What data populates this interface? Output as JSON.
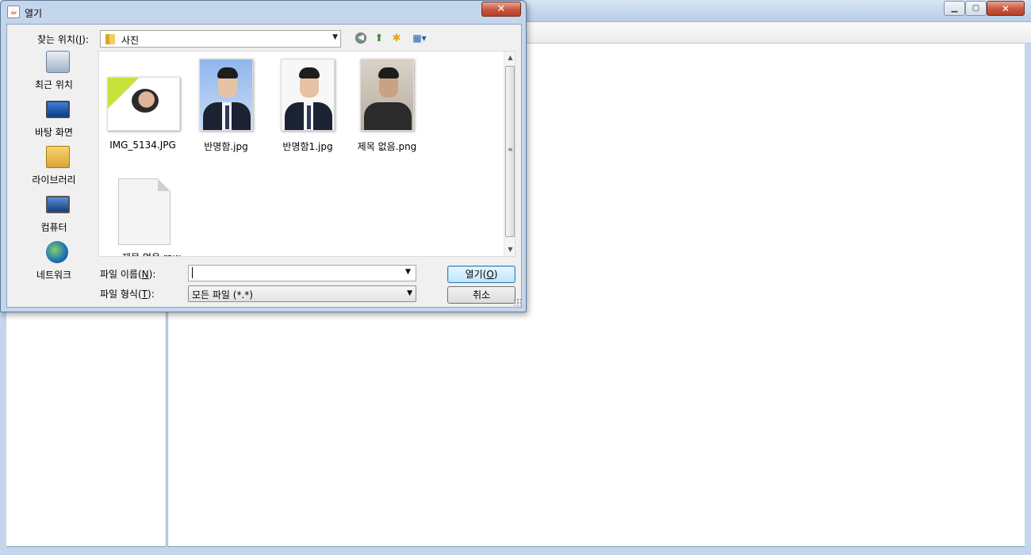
{
  "dialog": {
    "title": "열기",
    "look_in": {
      "label_pre": "찾는 위치(",
      "label_key": "I",
      "label_post": "):",
      "value": "사진"
    },
    "toolbar_icons": [
      "back-icon",
      "up-folder-icon",
      "new-folder-icon",
      "view-menu-icon"
    ],
    "places": [
      {
        "label": "최근 위치",
        "icon": "recent-places-icon"
      },
      {
        "label": "바탕 화면",
        "icon": "desktop-icon"
      },
      {
        "label": "라이브러리",
        "icon": "library-icon"
      },
      {
        "label": "컴퓨터",
        "icon": "computer-icon"
      },
      {
        "label": "네트워크",
        "icon": "network-icon"
      }
    ],
    "files": [
      {
        "name": "IMG_5134.JPG"
      },
      {
        "name": "반명함.jpg"
      },
      {
        "name": "반명함1.jpg"
      },
      {
        "name": "제목 없음.png"
      },
      {
        "name": "제목 없음.raw"
      }
    ],
    "file_name": {
      "label_pre": "파일 이름(",
      "label_key": "N",
      "label_post": "):",
      "value": ""
    },
    "file_type": {
      "label_pre": "파일 형식(",
      "label_key": "T",
      "label_post": "):",
      "value": "모든 파일 (*.*)"
    },
    "open_button": {
      "pre": "열기(",
      "key": "O",
      "post": ")"
    },
    "cancel_button": "취소"
  },
  "colors": {
    "accent_close": "#c8553d",
    "default_button": "#bee6fd",
    "window_frame": "#c4d6ec"
  }
}
